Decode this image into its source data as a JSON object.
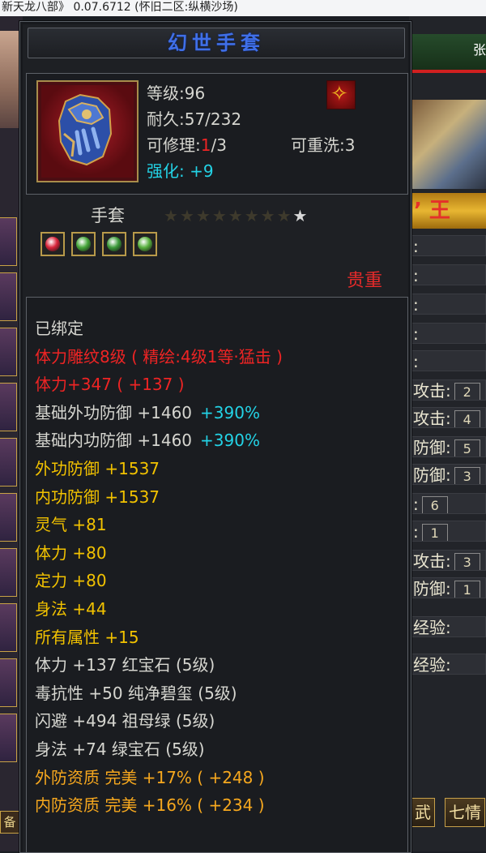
{
  "window": {
    "title": "新天龙八部》 0.07.6712 (怀旧二区:纵横沙场)"
  },
  "background": {
    "right_name_fragment": "’ 王",
    "right_top_fragment": "张",
    "right_rows": [
      {
        "label": ":",
        "value": ""
      },
      {
        "label": ":",
        "value": ""
      },
      {
        "label": ":",
        "value": ""
      },
      {
        "label": ":",
        "value": ""
      },
      {
        "label": ":",
        "value": ""
      },
      {
        "label": "攻击:",
        "value": "2"
      },
      {
        "label": "攻击:",
        "value": "4"
      },
      {
        "label": "防御:",
        "value": "5"
      },
      {
        "label": "防御:",
        "value": "3"
      },
      {
        "label": ":",
        "value": "6"
      },
      {
        "label": ":",
        "value": "1"
      },
      {
        "label": "攻击:",
        "value": "3"
      },
      {
        "label": "防御:",
        "value": "1"
      },
      {
        "label": "经验:",
        "value": ""
      },
      {
        "label": "经验:",
        "value": ""
      }
    ],
    "right_tabs": [
      "武",
      "七情"
    ],
    "left_bottom_button": "备"
  },
  "item": {
    "name": "幻世手套",
    "level_label": "等级:96",
    "durability_label": "耐久:57/232",
    "repair_label": "可修理:",
    "repair_used": "1",
    "repair_total": "/3",
    "reforge_label": "可重洗:3",
    "enhance_label": "强化:",
    "enhance_value": "+9",
    "type": "手套",
    "stars_total": 9,
    "stars_lit": 1,
    "rarity": "贵重",
    "gems": [
      {
        "color": "#d8243a"
      },
      {
        "color": "#46a63a"
      },
      {
        "color": "#3c9a3a"
      },
      {
        "color": "#58b03e"
      }
    ],
    "attributes": [
      {
        "text": "已绑定",
        "color": "white"
      },
      {
        "text": "体力雕纹8级 ( 精绘:4级1等·猛击 )",
        "color": "red"
      },
      {
        "text": "体力+347 ( +137 )",
        "color": "red"
      },
      {
        "text": "基础外功防御 +1460",
        "extra": "+390%",
        "color": "white"
      },
      {
        "text": "基础内功防御 +1460",
        "extra": "+390%",
        "color": "white"
      },
      {
        "text": "外功防御 +1537",
        "color": "yellow"
      },
      {
        "text": "内功防御 +1537",
        "color": "yellow"
      },
      {
        "text": "灵气 +81",
        "color": "yellow"
      },
      {
        "text": "体力 +80",
        "color": "yellow"
      },
      {
        "text": "定力 +80",
        "color": "yellow"
      },
      {
        "text": "身法 +44",
        "color": "yellow"
      },
      {
        "text": "所有属性 +15",
        "color": "yellow"
      },
      {
        "text": "体力 +137 红宝石 (5级)",
        "color": "white"
      },
      {
        "text": "毒抗性 +50 纯净碧玺 (5级)",
        "color": "white"
      },
      {
        "text": "闪避 +494 祖母绿 (5级)",
        "color": "white"
      },
      {
        "text": "身法 +74 绿宝石 (5级)",
        "color": "white"
      },
      {
        "text": "外防资质   完美  +17% ( +248 )",
        "color": "orange"
      },
      {
        "text": "内防资质   完美  +16% ( +234 )",
        "color": "orange"
      }
    ]
  }
}
